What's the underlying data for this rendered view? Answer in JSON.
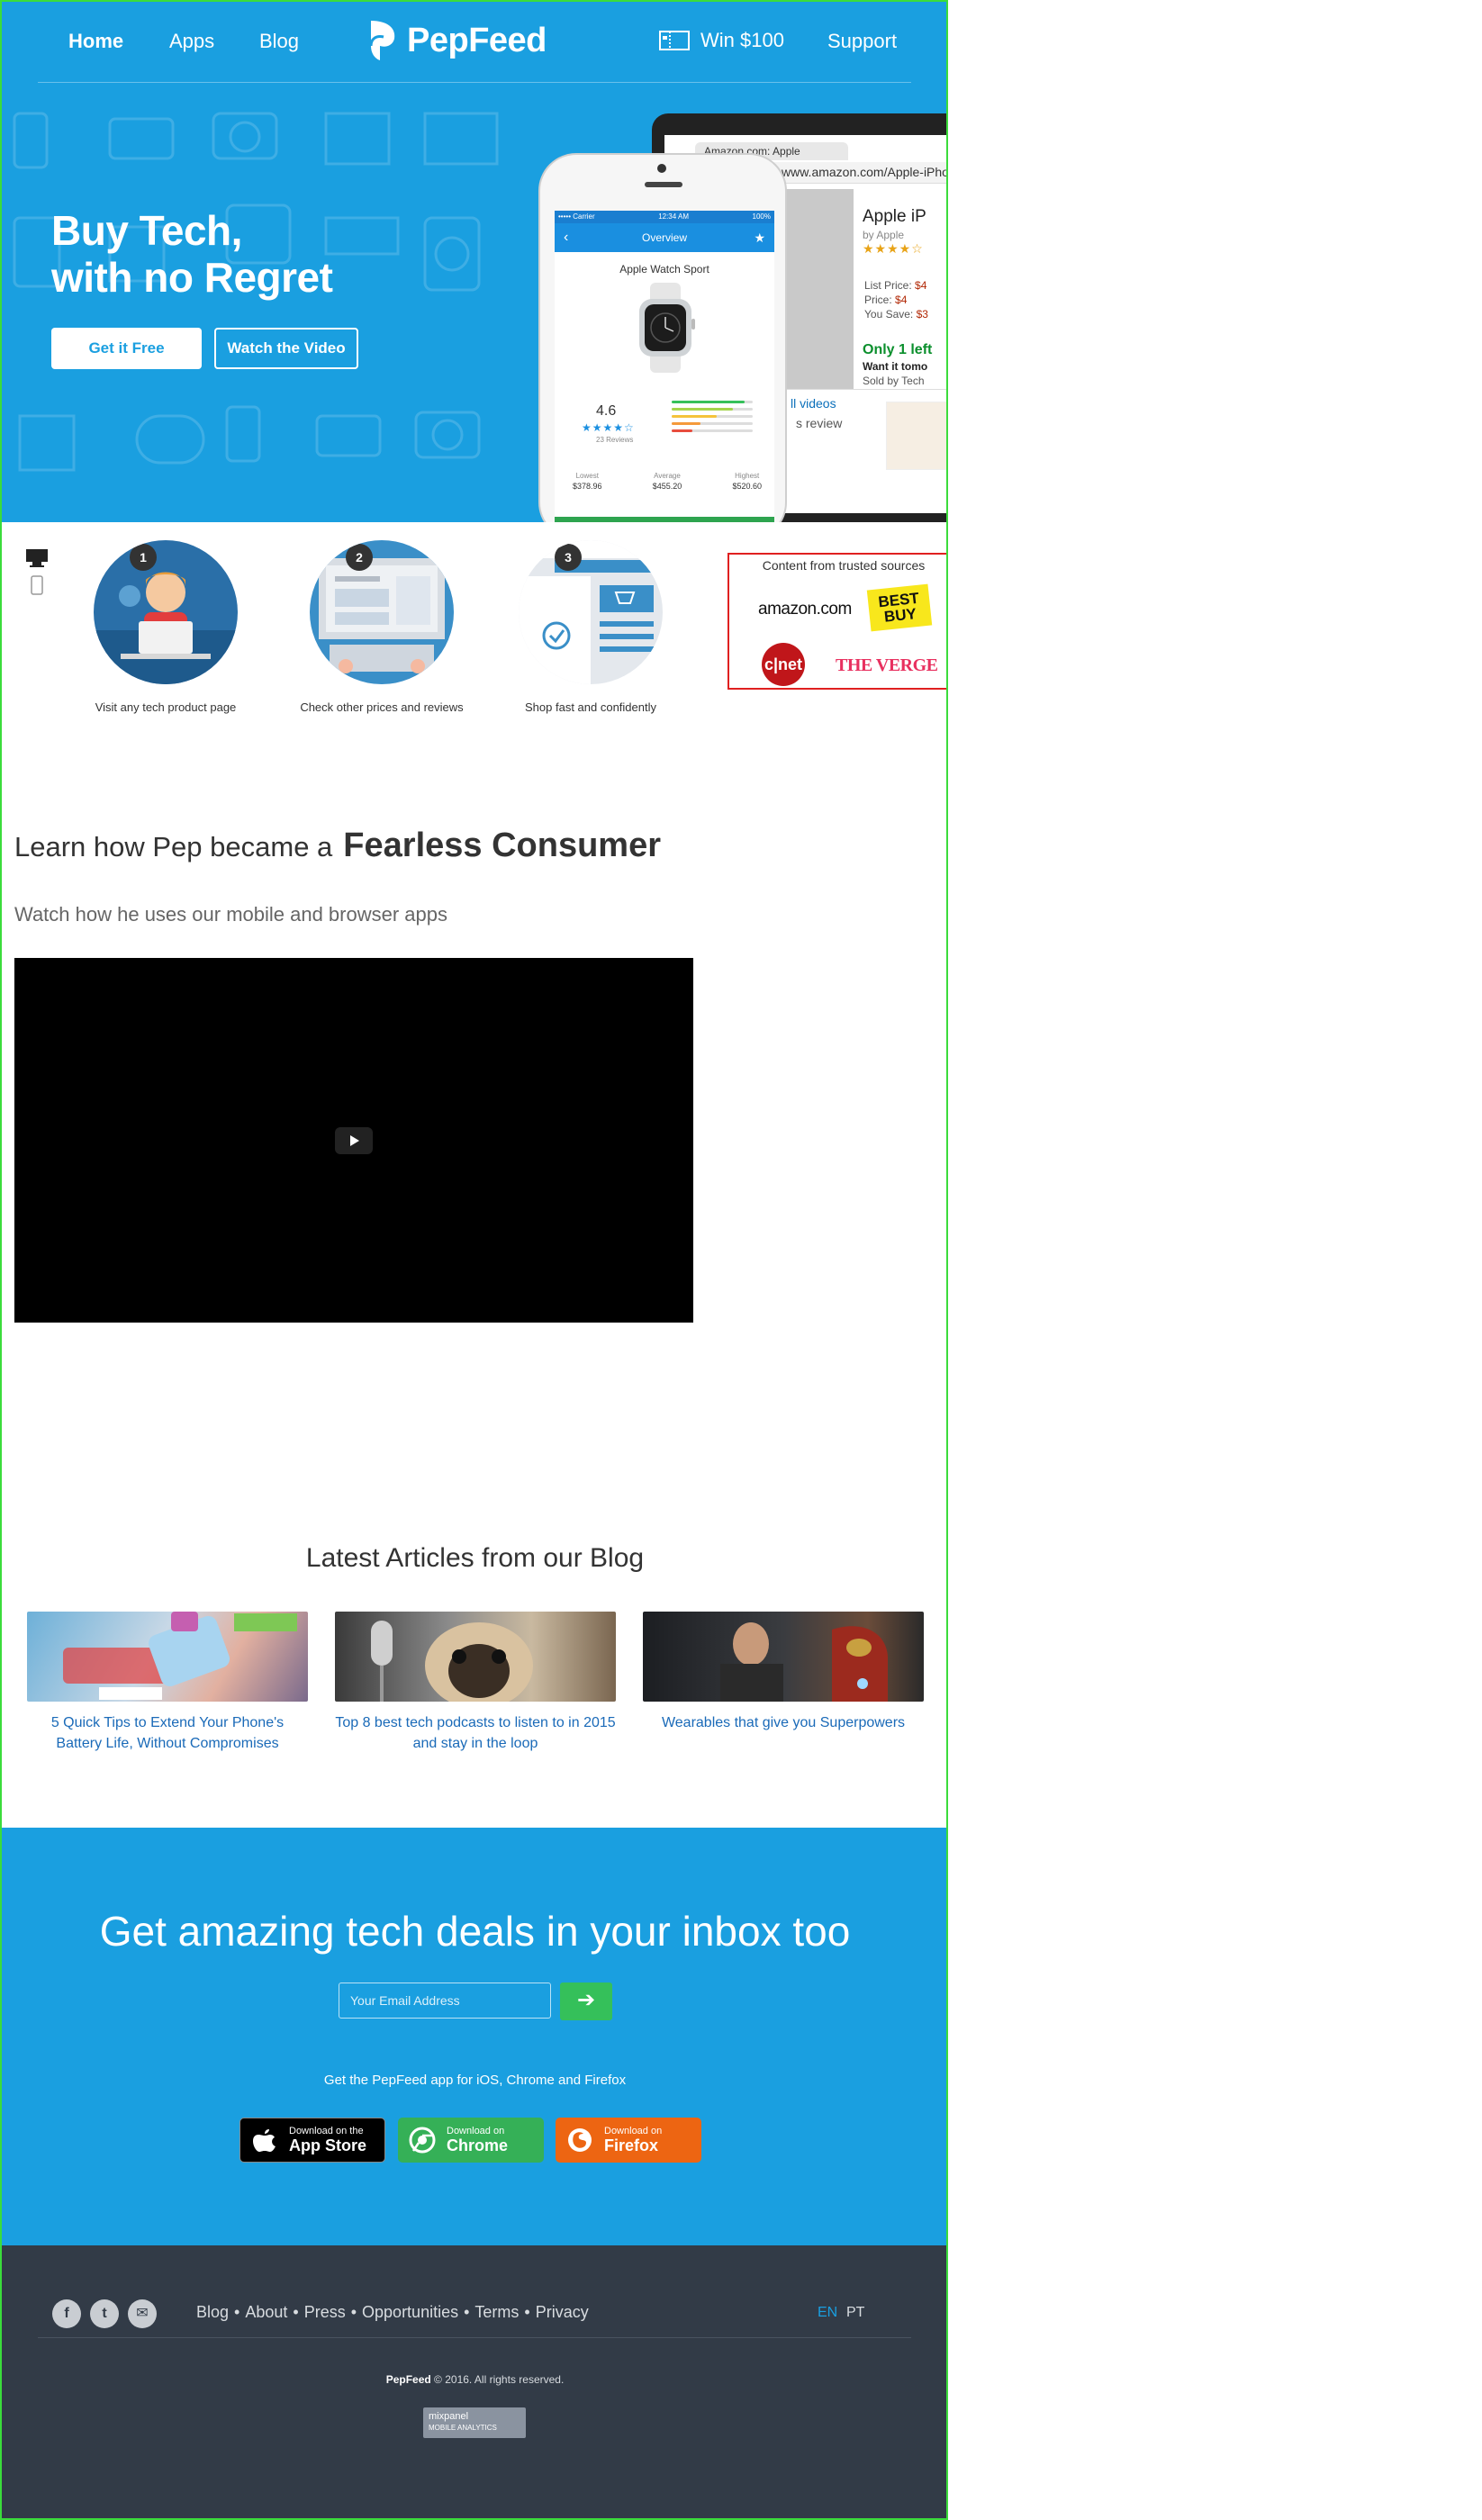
{
  "nav": {
    "home": "Home",
    "apps": "Apps",
    "blog": "Blog",
    "brand": "PepFeed",
    "win": "Win $100",
    "support": "Support"
  },
  "hero": {
    "title_line1": "Buy Tech,",
    "title_line2": "with no Regret",
    "cta_primary": "Get it Free",
    "cta_secondary": "Watch the Video"
  },
  "browser_mock": {
    "tab": "Amazon.com: Apple",
    "url": "www.amazon.com/Apple-iPho",
    "product_title": "Apple iP",
    "by": "by Apple",
    "stars": "★★★★☆",
    "list_price_label": "List Price:",
    "list_price": "$4",
    "price_label": "Price:",
    "price": "$4",
    "save_label": "You Save:",
    "save": "$3",
    "stock": "Only 1 left",
    "want": "Want it tomo",
    "sold": "Sold by Tech",
    "videos": "ll videos",
    "review": "s review"
  },
  "phone_mock": {
    "carrier": "••••• Carrier",
    "time": "12:34 AM",
    "battery": "100%",
    "header": "Overview",
    "product": "Apple Watch Sport",
    "score": "4.6",
    "stars": "★★★★☆",
    "reviews": "23 Reviews",
    "prices": [
      {
        "label": "Lowest",
        "value": "$378.96"
      },
      {
        "label": "Average",
        "value": "$455.20"
      },
      {
        "label": "Highest",
        "value": "$520.60"
      }
    ],
    "rating_bars": [
      0.9,
      0.75,
      0.55,
      0.35,
      0.25
    ],
    "rating_bar_colors": [
      "#35c05a",
      "#a3d44b",
      "#f5c33b",
      "#f59a3b",
      "#e84c3d"
    ]
  },
  "steps": [
    {
      "num": "1",
      "label": "Visit any tech product page"
    },
    {
      "num": "2",
      "label": "Check other prices and reviews"
    },
    {
      "num": "3",
      "label": "Shop fast and confidently"
    }
  ],
  "trusted": {
    "title": "Content from trusted sources",
    "amazon": "amazon.com",
    "bestbuy_line1": "BEST",
    "bestbuy_line2": "BUY",
    "cnet": "c|net",
    "verge": "THE VERGE"
  },
  "learn": {
    "title_a": "Learn how Pep became a",
    "title_b": "Fearless Consumer",
    "subtitle": "Watch how he uses our mobile and browser apps"
  },
  "blog": {
    "title": "Latest Articles from our Blog",
    "articles": [
      {
        "title": "5 Quick Tips to Extend Your Phone's Battery Life, Without Compromises"
      },
      {
        "title": "Top 8 best tech podcasts to listen to in 2015 and stay in the loop"
      },
      {
        "title": "Wearables that give you Superpowers"
      }
    ]
  },
  "newsletter": {
    "title": "Get amazing tech deals in your inbox too",
    "email_placeholder": "Your Email Address",
    "submit_icon": "➔",
    "apps_note": "Get the PepFeed app for iOS, Chrome and Firefox",
    "stores": [
      {
        "small": "Download on the",
        "large": "App Store",
        "icon": "apple-icon"
      },
      {
        "small": "Download on",
        "large": "Chrome",
        "icon": "chrome-icon"
      },
      {
        "small": "Download on",
        "large": "Firefox",
        "icon": "firefox-icon"
      }
    ]
  },
  "footer": {
    "links": [
      "Blog",
      "About",
      "Press",
      "Opportunities",
      "Terms",
      "Privacy"
    ],
    "separator": "•",
    "lang_en": "EN",
    "lang_pt": "PT",
    "copyright_brand": "PepFeed",
    "copyright_rest": "© 2016. All rights reserved.",
    "mixpanel_line1": "mixpanel",
    "mixpanel_line2": "MOBILE ANALYTICS",
    "social": [
      {
        "icon": "facebook-icon",
        "glyph": "f"
      },
      {
        "icon": "twitter-icon",
        "glyph": "t"
      },
      {
        "icon": "email-icon",
        "glyph": "✉"
      }
    ]
  },
  "colors": {
    "brand_blue": "#1a9fe0",
    "cta_green": "#35c05a",
    "footer_bg": "#323b47",
    "link_blue": "#1a6ab8"
  }
}
